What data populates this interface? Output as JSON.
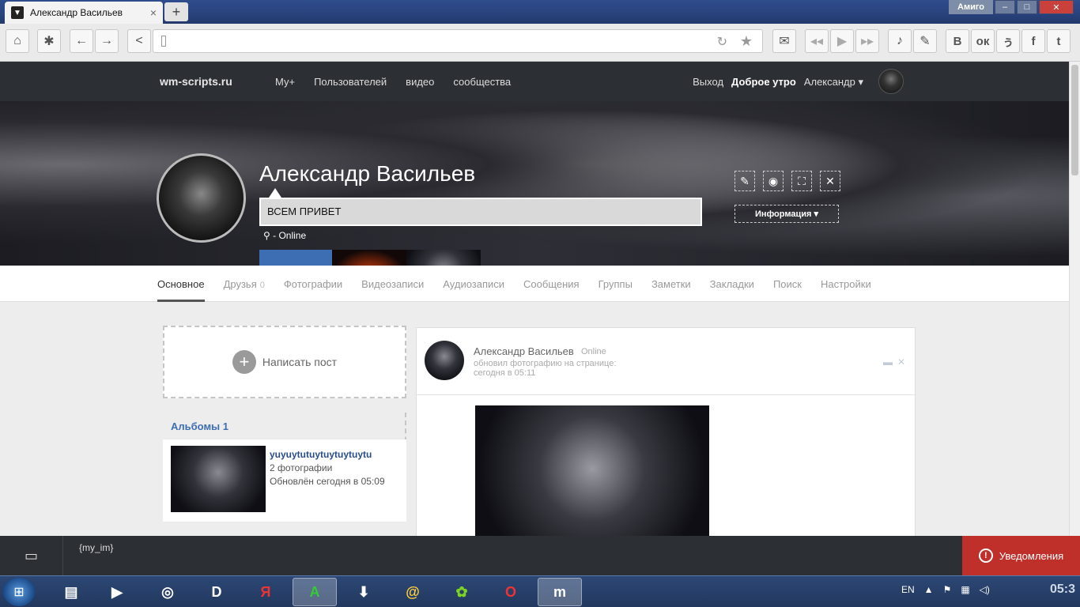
{
  "browser": {
    "tab_title": "Александр Васильев",
    "tab_close": "×",
    "new_tab": "+",
    "brand": "Амиго",
    "min": "–",
    "max": "□",
    "close": "✕",
    "toolbar_social": [
      "B",
      "ок",
      "ぅ",
      "f",
      "t"
    ]
  },
  "site": {
    "logo": "wm-scripts.ru",
    "nav": [
      "Му+",
      "Пользователей",
      "видео",
      "сообщества"
    ],
    "logout": "Выход",
    "greeting": "Доброе утро",
    "user": "Александр ▾"
  },
  "profile": {
    "name": "Александр Васильев",
    "status": "ВСЕМ ПРИВЕТ",
    "location": "- Online",
    "info_button": "Информация ▾"
  },
  "tabs": {
    "items": [
      "Основное",
      "Друзья",
      "Фотографии",
      "Видеозаписи",
      "Аудиозаписи",
      "Сообщения",
      "Группы",
      "Заметки",
      "Закладки",
      "Поиск",
      "Настройки"
    ],
    "friends_count": "0"
  },
  "write_post": "Написать пост",
  "albums": {
    "header": "Альбомы 1",
    "title": "yuyuytutuytuytuytuytu",
    "count": "2 фотографии",
    "updated": "Обновлён сегодня в 05:09"
  },
  "post": {
    "author": "Александр Васильев",
    "online": "Online",
    "action": "обновил фотографию на странице:",
    "time": "сегодня в 05:11"
  },
  "imbar": {
    "text": "{my_im}",
    "notifications": "Уведомления"
  },
  "taskbar": {
    "lang": "EN",
    "clock": "05:3"
  }
}
